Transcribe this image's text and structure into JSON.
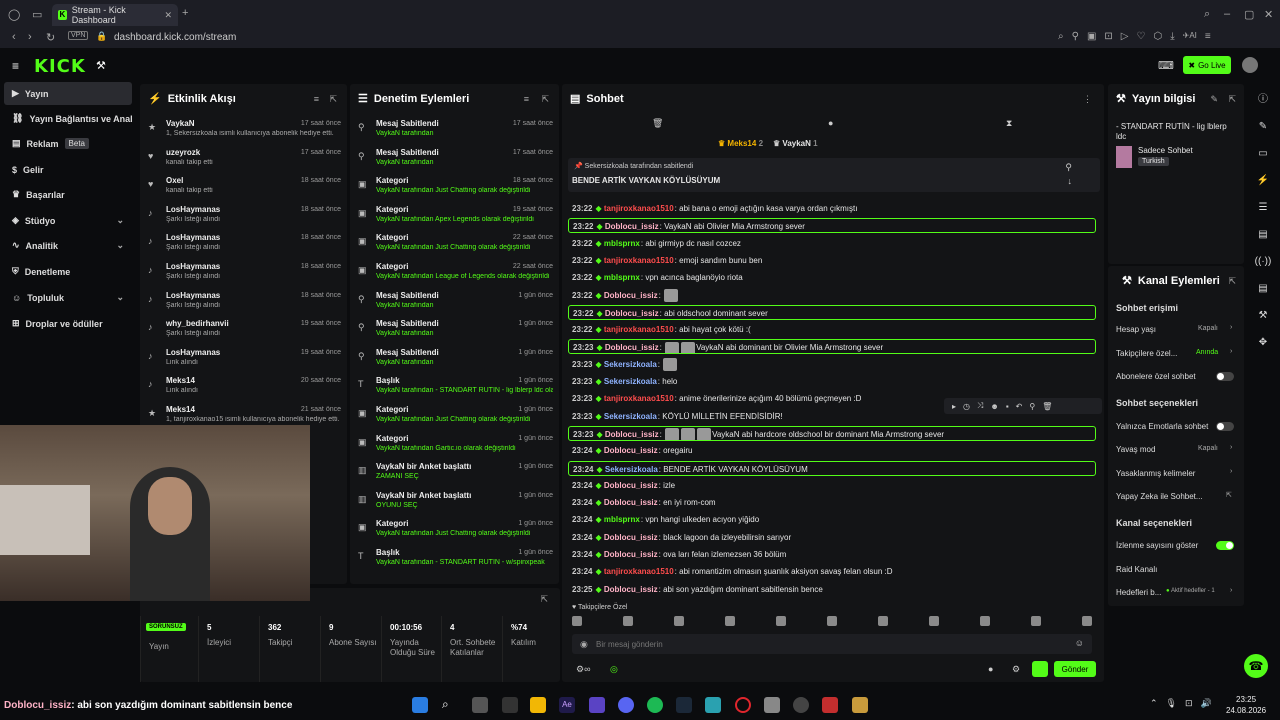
{
  "browser": {
    "tab_title": "Stream - Kick Dashboard",
    "vpn": "VPN",
    "url": "dashboard.kick.com/stream",
    "ai_label": "AI"
  },
  "kick": {
    "logo": "KICK",
    "go_live": "Go Live"
  },
  "nav": {
    "items": [
      {
        "label": "Yayın",
        "icon": "video-icon"
      },
      {
        "label": "Yayın Bağlantısı ve Anahtarı",
        "icon": "link-icon"
      },
      {
        "label": "Reklam",
        "icon": "ad-icon",
        "badge": "Beta"
      },
      {
        "label": "Gelir",
        "icon": "dollar-icon"
      },
      {
        "label": "Başarılar",
        "icon": "trophy-icon"
      },
      {
        "label": "Stüdyo",
        "icon": "studio-icon"
      },
      {
        "label": "Analitik",
        "icon": "analytics-icon"
      },
      {
        "label": "Denetleme",
        "icon": "shield-icon"
      },
      {
        "label": "Topluluk",
        "icon": "community-icon"
      },
      {
        "label": "Droplar ve ödüller",
        "icon": "gift-icon"
      }
    ]
  },
  "activity": {
    "title": "Etkinlik Akışı",
    "items": [
      {
        "user": "VaykaN",
        "detail": "1, Sekersizkoala isimli kullanıcıya abonelik hediye etti.",
        "time": "17 saat önce"
      },
      {
        "user": "uzeyrozk",
        "detail": "kanalı takip etti",
        "time": "17 saat önce"
      },
      {
        "user": "Oxel",
        "detail": "kanalı takip etti",
        "time": "18 saat önce"
      },
      {
        "user": "LosHaymanas",
        "detail": "Şarkı İsteği alındı",
        "time": "18 saat önce"
      },
      {
        "user": "LosHaymanas",
        "detail": "Şarkı İsteği alındı",
        "time": "18 saat önce"
      },
      {
        "user": "LosHaymanas",
        "detail": "Şarkı İsteği alındı",
        "time": "18 saat önce"
      },
      {
        "user": "LosHaymanas",
        "detail": "Şarkı İsteği alındı",
        "time": "18 saat önce"
      },
      {
        "user": "why_bedirhanvii",
        "detail": "Şarkı İsteği alındı",
        "time": "19 saat önce"
      },
      {
        "user": "LosHaymanas",
        "detail": "Link alındı",
        "time": "19 saat önce"
      },
      {
        "user": "Meks14",
        "detail": "Link alındı",
        "time": "20 saat önce"
      },
      {
        "user": "Meks14",
        "detail": "1, tanjiroxkanao15 isimli kullanıcıya abonelik hediye etti.",
        "time": "21 saat önce"
      }
    ]
  },
  "moderation": {
    "title": "Denetim Eylemleri",
    "items": [
      {
        "action": "Mesaj Sabitlendi",
        "detail": "VaykaN tarafından",
        "time": "17 saat önce"
      },
      {
        "action": "Mesaj Sabitlendi",
        "detail": "VaykaN tarafından",
        "time": "17 saat önce"
      },
      {
        "action": "Kategori",
        "detail": "VaykaN tarafından Just Chatting olarak değiştirildi",
        "time": "18 saat önce"
      },
      {
        "action": "Kategori",
        "detail": "VaykaN tarafından Apex Legends olarak değiştirildi",
        "time": "19 saat önce"
      },
      {
        "action": "Kategori",
        "detail": "VaykaN tarafından Just Chatting olarak değiştirildi",
        "time": "22 saat önce"
      },
      {
        "action": "Kategori",
        "detail": "VaykaN tarafından League of Legends olarak değiştirildi",
        "time": "22 saat önce"
      },
      {
        "action": "Mesaj Sabitlendi",
        "detail": "VaykaN tarafından",
        "time": "1 gün önce"
      },
      {
        "action": "Mesaj Sabitlendi",
        "detail": "VaykaN tarafından",
        "time": "1 gün önce"
      },
      {
        "action": "Mesaj Sabitlendi",
        "detail": "VaykaN tarafından",
        "time": "1 gün önce"
      },
      {
        "action": "Başlık",
        "detail": "VaykaN tarafından - STANDART RUTİN - lig lblerp ldc olarak değiştirildi",
        "time": "1 gün önce"
      },
      {
        "action": "Kategori",
        "detail": "VaykaN tarafından Just Chatting olarak değiştirildi",
        "time": "1 gün önce"
      },
      {
        "action": "Kategori",
        "detail": "VaykaN tarafından Gartic.io olarak değiştirildi",
        "time": "1 gün önce"
      },
      {
        "action": "VaykaN bir Anket başlattı",
        "detail": "ZAMANI SEÇ",
        "time": "1 gün önce"
      },
      {
        "action": "VaykaN bir Anket başlattı",
        "detail": "OYUNU SEÇ",
        "time": "1 gün önce"
      },
      {
        "action": "Kategori",
        "detail": "VaykaN tarafından Just Chatting olarak değiştirildi",
        "time": "1 gün önce"
      },
      {
        "action": "Başlık",
        "detail": "VaykaN tarafından - STANDART RUTİN - w/spinxpeak",
        "time": "1 gün önce"
      }
    ]
  },
  "chat": {
    "title": "Sohbet",
    "leaders": [
      {
        "name": "Meks14",
        "count": "2"
      },
      {
        "name": "VaykaN",
        "count": "1"
      }
    ],
    "pinned_by": "Sekersizkoala tarafından sabitlendi",
    "pinned_text": "BENDE ARTİK VAYKAN KÖYLÜSÜYUM",
    "messages": [
      {
        "time": "23:22",
        "user": "tanjiroxkanao1510",
        "color": "#ff4d4d",
        "text": "abi bana o emoji açtığın kasa varya ordan çıkmıştı",
        "hl": false
      },
      {
        "time": "23:22",
        "user": "Doblocu_issiz",
        "color": "#ffb3c7",
        "text": "VaykaN abi Olivier Mia Armstrong sever",
        "hl": true
      },
      {
        "time": "23:22",
        "user": "mblsprnx",
        "color": "#53fc18",
        "text": "abi girmiyp dc nasıl cozcez",
        "hl": false
      },
      {
        "time": "23:22",
        "user": "tanjiroxkanao1510",
        "color": "#ff4d4d",
        "text": "emoji sandım bunu ben",
        "hl": false
      },
      {
        "time": "23:22",
        "user": "mblsprnx",
        "color": "#53fc18",
        "text": "vpn acınca baglanöyio riota",
        "hl": false
      },
      {
        "time": "23:22",
        "user": "Doblocu_issiz",
        "color": "#ffb3c7",
        "text": "",
        "hl": false,
        "emotes": 1
      },
      {
        "time": "23:22",
        "user": "Doblocu_issiz",
        "color": "#ffb3c7",
        "text": "abi oldschool dominant sever",
        "hl": true
      },
      {
        "time": "23:22",
        "user": "tanjiroxkanao1510",
        "color": "#ff4d4d",
        "text": "abi hayat çok kötü :(",
        "hl": false
      },
      {
        "time": "23:23",
        "user": "Doblocu_issiz",
        "color": "#ffb3c7",
        "text": "VaykaN abi dominant bir Olivier Mia Armstrong sever",
        "hl": true,
        "emotes": 2
      },
      {
        "time": "23:23",
        "user": "Sekersizkoala",
        "color": "#8fb3ff",
        "text": "",
        "hl": false,
        "emotes": 1
      },
      {
        "time": "23:23",
        "user": "Sekersizkoala",
        "color": "#8fb3ff",
        "text": "helo",
        "hl": false
      },
      {
        "time": "23:23",
        "user": "tanjiroxkanao1510",
        "color": "#ff4d4d",
        "text": "anime önerilerinize açığım 40 bölümü geçmeyen :D",
        "hl": false
      },
      {
        "time": "23:23",
        "user": "Sekersizkoala",
        "color": "#8fb3ff",
        "text": "KÖYLÜ MİLLETİN EFENDİSİDİR!",
        "hl": false
      },
      {
        "time": "23:23",
        "user": "Doblocu_issiz",
        "color": "#ffb3c7",
        "text": "VaykaN abi hardcore oldschool bir dominant Mia Armstrong sever",
        "hl": true,
        "emotes": 3
      },
      {
        "time": "23:24",
        "user": "Doblocu_issiz",
        "color": "#ffb3c7",
        "text": "oregairu",
        "hl": false
      },
      {
        "time": "23:24",
        "user": "Sekersizkoala",
        "color": "#8fb3ff",
        "text": "BENDE ARTİK VAYKAN KÖYLÜSÜYUM",
        "hl": true
      },
      {
        "time": "23:24",
        "user": "Doblocu_issiz",
        "color": "#ffb3c7",
        "text": "izle",
        "hl": false
      },
      {
        "time": "23:24",
        "user": "Doblocu_issiz",
        "color": "#ffb3c7",
        "text": "en iyi rom-com",
        "hl": false
      },
      {
        "time": "23:24",
        "user": "mblsprnx",
        "color": "#53fc18",
        "text": "vpn hangi ulkeden acıyon yiğido",
        "hl": false
      },
      {
        "time": "23:24",
        "user": "Doblocu_issiz",
        "color": "#ffb3c7",
        "text": "black lagoon da izleyebilirsin sarıyor",
        "hl": false
      },
      {
        "time": "23:24",
        "user": "Doblocu_issiz",
        "color": "#ffb3c7",
        "text": "ova ları felan izlemezsen 36 bölüm",
        "hl": false
      },
      {
        "time": "23:24",
        "user": "tanjiroxkanao1510",
        "color": "#ff4d4d",
        "text": "abi romantizim olmasın şuanlık aksiyon savaş felan olsun :D",
        "hl": false
      },
      {
        "time": "23:25",
        "user": "Doblocu_issiz",
        "color": "#ffb3c7",
        "text": "abi son yazdığım dominant sabitlensin bence",
        "hl": false
      }
    ],
    "followers_label": "Takipçilere Özel",
    "input_placeholder": "Bir mesaj gönderin",
    "send": "Gönder"
  },
  "stream_info": {
    "title": "Yayın bilgisi",
    "stream_title": "- STANDART RUTİN - lig lblerp ldc",
    "category": "Sadece Sohbet",
    "language": "Turkish"
  },
  "channel_actions": {
    "title": "Kanal Eylemleri",
    "chat_access": "Sohbet erişimi",
    "account_age": "Hesap yaşı",
    "account_age_val": "Kapalı",
    "followers_only": "Takipçilere özel...",
    "followers_only_val": "Anında",
    "subs_only": "Abonelere özel sohbet",
    "chat_options": "Sohbet seçenekleri",
    "emote_only": "Yalnızca Emotlarla sohbet",
    "slow_mode": "Yavaş mod",
    "slow_mode_val": "Kapalı",
    "banned_words": "Yasaklanmış kelimeler",
    "ai_chat": "Yapay Zeka ile Sohbet...",
    "channel_options": "Kanal seçenekleri",
    "show_viewers": "İzlenme sayısını göster",
    "raid": "Raid Kanalı",
    "goals": "Hedefleri b...",
    "goals_val": "Aktif hedefler - 1"
  },
  "stats": {
    "badge": "SORUNSUZ",
    "items": [
      {
        "value": "",
        "label": "Yayın"
      },
      {
        "value": "5",
        "label": "İzleyici"
      },
      {
        "value": "362",
        "label": "Takipçi"
      },
      {
        "value": "9",
        "label": "Abone Sayısı"
      },
      {
        "value": "00:10:56",
        "label": "Yayında Olduğu Süre"
      },
      {
        "value": "4",
        "label": "Ort. Sohbete Katılanlar"
      },
      {
        "value": "%74",
        "label": "Katılım"
      }
    ]
  },
  "overlay_message": {
    "user": "Doblocu_issiz",
    "text": ": abi son yazdığım dominant sabitlensin bence"
  },
  "taskbar": {
    "time": "23:25",
    "date": "24.08.2026"
  }
}
